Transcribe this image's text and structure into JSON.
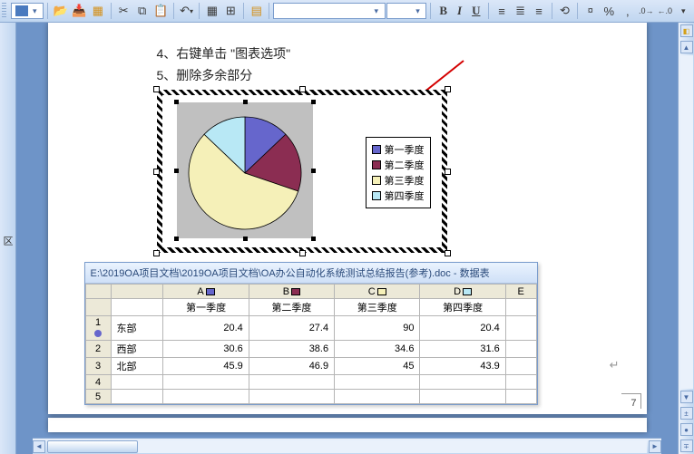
{
  "status_left": "区",
  "body": {
    "line4": "4、右键单击 \"图表选项\"",
    "line5": "5、删除多余部分"
  },
  "chart_data": {
    "type": "pie",
    "categories": [
      "第一季度",
      "第二季度",
      "第三季度",
      "第四季度"
    ],
    "values": [
      20.4,
      27.4,
      90,
      20.4
    ],
    "series_colors": [
      "#6666cc",
      "#8b2d52",
      "#f5f0b8",
      "#b8e8f5"
    ],
    "legend": [
      "第一季度",
      "第二季度",
      "第三季度",
      "第四季度"
    ]
  },
  "datasheet": {
    "title": "E:\\2019OA项目文档\\2019OA项目文档\\OA办公自动化系统测试总结报告(参考).doc - 数据表",
    "col_letters": [
      "A",
      "B",
      "C",
      "D",
      "E"
    ],
    "col_headers": [
      "",
      "第一季度",
      "第二季度",
      "第三季度",
      "第四季度",
      ""
    ],
    "rows": [
      {
        "n": "1",
        "name": "东部",
        "mark": "#6666cc",
        "vals": [
          "20.4",
          "27.4",
          "90",
          "20.4",
          ""
        ]
      },
      {
        "n": "2",
        "name": "西部",
        "mark": "",
        "vals": [
          "30.6",
          "38.6",
          "34.6",
          "31.6",
          ""
        ]
      },
      {
        "n": "3",
        "name": "北部",
        "mark": "",
        "vals": [
          "45.9",
          "46.9",
          "45",
          "43.9",
          ""
        ]
      },
      {
        "n": "4",
        "name": "",
        "mark": "",
        "vals": [
          "",
          "",
          "",
          "",
          ""
        ]
      },
      {
        "n": "5",
        "name": "",
        "mark": "",
        "vals": [
          "",
          "",
          "",
          "",
          ""
        ]
      }
    ],
    "col_swatches": [
      "#6666cc",
      "#8b2d52",
      "#f5f0b8",
      "#b8e8f5",
      ""
    ]
  },
  "page_number": "7",
  "toolbar": {
    "font_combo": "",
    "size_combo": ""
  }
}
